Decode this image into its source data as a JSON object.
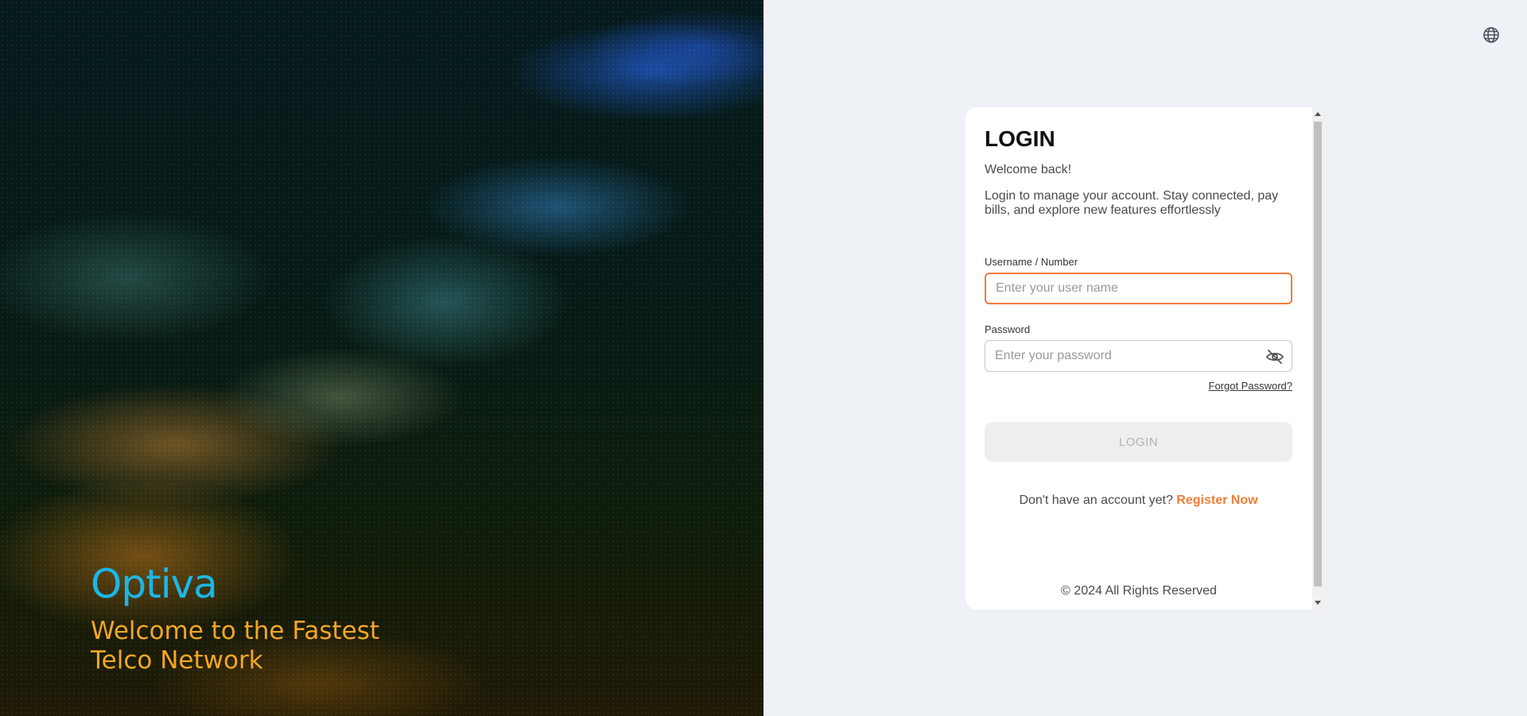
{
  "hero": {
    "logo": "Optiva",
    "tagline": "Welcome to the Fastest Telco Network"
  },
  "language": {
    "icon": "globe-icon"
  },
  "login": {
    "title": "LOGIN",
    "welcome": "Welcome back!",
    "description": "Login to manage your account. Stay connected, pay bills, and explore new features effortlessly",
    "username_label": "Username / Number",
    "username_placeholder": "Enter your user name",
    "username_value": "",
    "password_label": "Password",
    "password_placeholder": "Enter your password",
    "password_value": "",
    "password_toggle_icon": "eye-off-icon",
    "forgot_password": "Forgot Password?",
    "login_button": "LOGIN",
    "register_prompt": "Don't have an account yet?",
    "register_link": "Register Now",
    "copyright": "2024 All Rights Reserved"
  },
  "colors": {
    "accent": "#f07c3a",
    "brand_blue": "#1bb7e8",
    "tagline_orange": "#f5a623"
  }
}
